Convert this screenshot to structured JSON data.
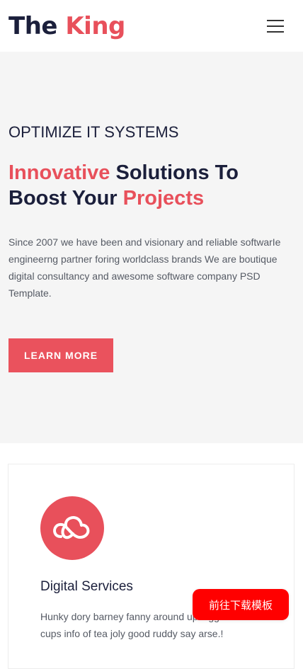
{
  "header": {
    "logo_part1": "The",
    "logo_part2": "King",
    "menu_icon": "hamburger-menu-icon"
  },
  "hero": {
    "eyebrow": "OPTIMIZE IT SYSTEMS",
    "headline_accent1": "Innovative",
    "headline_mid": " Solutions To Boost Your ",
    "headline_accent2": "Projects",
    "description": "Since 2007 we have been and visionary and reliable softwarIe engineerng partner foring worldclass brands We are boutique digital consultancy and awesome software company PSD Template.",
    "cta_label": "LEARN MORE"
  },
  "service": {
    "icon": "cloud-icon",
    "title": "Digital Services",
    "description": "Hunky dory barney fanny around up bigge look cups info of tea joly good ruddy say arse.!"
  },
  "floating": {
    "download_label": "前往下载模板"
  },
  "colors": {
    "accent": "#e8505b",
    "dark": "#1b1f3b",
    "hero_bg": "#f5f5f5",
    "download_bg": "#ff0000"
  }
}
